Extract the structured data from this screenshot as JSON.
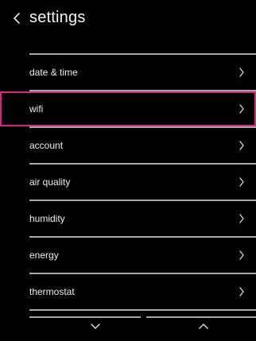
{
  "header": {
    "title": "settings",
    "back_icon": "chevron-left-icon"
  },
  "menu": {
    "items": [
      {
        "label": "date & time",
        "icon": "chevron-right-icon",
        "selected": false
      },
      {
        "label": "wifi",
        "icon": "chevron-right-icon",
        "selected": true
      },
      {
        "label": "account",
        "icon": "chevron-right-icon",
        "selected": false
      },
      {
        "label": "air quality",
        "icon": "chevron-right-icon",
        "selected": false
      },
      {
        "label": "humidity",
        "icon": "chevron-right-icon",
        "selected": false
      },
      {
        "label": "energy",
        "icon": "chevron-right-icon",
        "selected": false
      },
      {
        "label": "thermostat",
        "icon": "chevron-right-icon",
        "selected": false
      }
    ]
  },
  "footer": {
    "scroll_down_icon": "chevron-down-icon",
    "scroll_up_icon": "chevron-up-icon"
  },
  "colors": {
    "background": "#000000",
    "text": "#f2f2f2",
    "divider": "#a8a8a8",
    "selection_outline": "#d8277c"
  }
}
